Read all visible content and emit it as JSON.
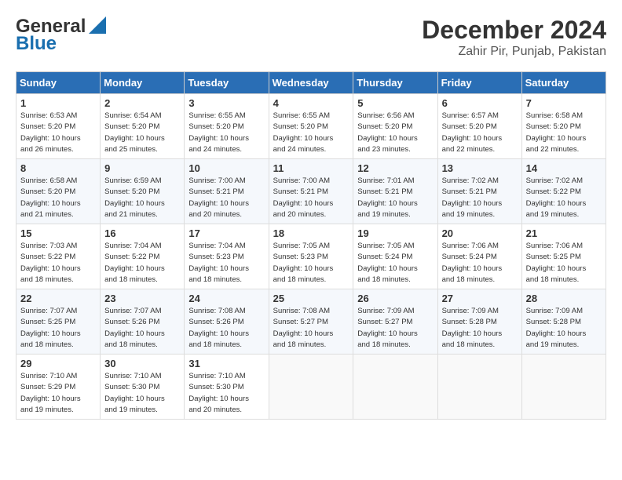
{
  "header": {
    "logo_line1": "General",
    "logo_line2": "Blue",
    "month_year": "December 2024",
    "location": "Zahir Pir, Punjab, Pakistan"
  },
  "weekdays": [
    "Sunday",
    "Monday",
    "Tuesday",
    "Wednesday",
    "Thursday",
    "Friday",
    "Saturday"
  ],
  "weeks": [
    [
      {
        "day": "1",
        "sunrise": "6:53 AM",
        "sunset": "5:20 PM",
        "daylight": "10 hours and 26 minutes."
      },
      {
        "day": "2",
        "sunrise": "6:54 AM",
        "sunset": "5:20 PM",
        "daylight": "10 hours and 25 minutes."
      },
      {
        "day": "3",
        "sunrise": "6:55 AM",
        "sunset": "5:20 PM",
        "daylight": "10 hours and 24 minutes."
      },
      {
        "day": "4",
        "sunrise": "6:55 AM",
        "sunset": "5:20 PM",
        "daylight": "10 hours and 24 minutes."
      },
      {
        "day": "5",
        "sunrise": "6:56 AM",
        "sunset": "5:20 PM",
        "daylight": "10 hours and 23 minutes."
      },
      {
        "day": "6",
        "sunrise": "6:57 AM",
        "sunset": "5:20 PM",
        "daylight": "10 hours and 22 minutes."
      },
      {
        "day": "7",
        "sunrise": "6:58 AM",
        "sunset": "5:20 PM",
        "daylight": "10 hours and 22 minutes."
      }
    ],
    [
      {
        "day": "8",
        "sunrise": "6:58 AM",
        "sunset": "5:20 PM",
        "daylight": "10 hours and 21 minutes."
      },
      {
        "day": "9",
        "sunrise": "6:59 AM",
        "sunset": "5:20 PM",
        "daylight": "10 hours and 21 minutes."
      },
      {
        "day": "10",
        "sunrise": "7:00 AM",
        "sunset": "5:21 PM",
        "daylight": "10 hours and 20 minutes."
      },
      {
        "day": "11",
        "sunrise": "7:00 AM",
        "sunset": "5:21 PM",
        "daylight": "10 hours and 20 minutes."
      },
      {
        "day": "12",
        "sunrise": "7:01 AM",
        "sunset": "5:21 PM",
        "daylight": "10 hours and 19 minutes."
      },
      {
        "day": "13",
        "sunrise": "7:02 AM",
        "sunset": "5:21 PM",
        "daylight": "10 hours and 19 minutes."
      },
      {
        "day": "14",
        "sunrise": "7:02 AM",
        "sunset": "5:22 PM",
        "daylight": "10 hours and 19 minutes."
      }
    ],
    [
      {
        "day": "15",
        "sunrise": "7:03 AM",
        "sunset": "5:22 PM",
        "daylight": "10 hours and 18 minutes."
      },
      {
        "day": "16",
        "sunrise": "7:04 AM",
        "sunset": "5:22 PM",
        "daylight": "10 hours and 18 minutes."
      },
      {
        "day": "17",
        "sunrise": "7:04 AM",
        "sunset": "5:23 PM",
        "daylight": "10 hours and 18 minutes."
      },
      {
        "day": "18",
        "sunrise": "7:05 AM",
        "sunset": "5:23 PM",
        "daylight": "10 hours and 18 minutes."
      },
      {
        "day": "19",
        "sunrise": "7:05 AM",
        "sunset": "5:24 PM",
        "daylight": "10 hours and 18 minutes."
      },
      {
        "day": "20",
        "sunrise": "7:06 AM",
        "sunset": "5:24 PM",
        "daylight": "10 hours and 18 minutes."
      },
      {
        "day": "21",
        "sunrise": "7:06 AM",
        "sunset": "5:25 PM",
        "daylight": "10 hours and 18 minutes."
      }
    ],
    [
      {
        "day": "22",
        "sunrise": "7:07 AM",
        "sunset": "5:25 PM",
        "daylight": "10 hours and 18 minutes."
      },
      {
        "day": "23",
        "sunrise": "7:07 AM",
        "sunset": "5:26 PM",
        "daylight": "10 hours and 18 minutes."
      },
      {
        "day": "24",
        "sunrise": "7:08 AM",
        "sunset": "5:26 PM",
        "daylight": "10 hours and 18 minutes."
      },
      {
        "day": "25",
        "sunrise": "7:08 AM",
        "sunset": "5:27 PM",
        "daylight": "10 hours and 18 minutes."
      },
      {
        "day": "26",
        "sunrise": "7:09 AM",
        "sunset": "5:27 PM",
        "daylight": "10 hours and 18 minutes."
      },
      {
        "day": "27",
        "sunrise": "7:09 AM",
        "sunset": "5:28 PM",
        "daylight": "10 hours and 18 minutes."
      },
      {
        "day": "28",
        "sunrise": "7:09 AM",
        "sunset": "5:28 PM",
        "daylight": "10 hours and 19 minutes."
      }
    ],
    [
      {
        "day": "29",
        "sunrise": "7:10 AM",
        "sunset": "5:29 PM",
        "daylight": "10 hours and 19 minutes."
      },
      {
        "day": "30",
        "sunrise": "7:10 AM",
        "sunset": "5:30 PM",
        "daylight": "10 hours and 19 minutes."
      },
      {
        "day": "31",
        "sunrise": "7:10 AM",
        "sunset": "5:30 PM",
        "daylight": "10 hours and 20 minutes."
      },
      null,
      null,
      null,
      null
    ]
  ],
  "labels": {
    "sunrise": "Sunrise:",
    "sunset": "Sunset:",
    "daylight": "Daylight:"
  }
}
